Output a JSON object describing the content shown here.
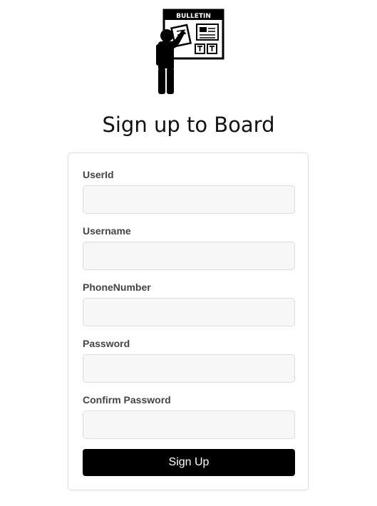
{
  "logo": {
    "icon": "bulletin-board-person-icon",
    "text": "BULLETIN"
  },
  "page": {
    "title": "Sign up to Board"
  },
  "form": {
    "fields": [
      {
        "label": "UserId",
        "value": "",
        "placeholder": ""
      },
      {
        "label": "Username",
        "value": "",
        "placeholder": ""
      },
      {
        "label": "PhoneNumber",
        "value": "",
        "placeholder": ""
      },
      {
        "label": "Password",
        "value": "",
        "placeholder": ""
      },
      {
        "label": "Confirm Password",
        "value": "",
        "placeholder": ""
      }
    ],
    "submit_label": "Sign Up"
  },
  "colors": {
    "button_background": "#000000",
    "button_text": "#ffffff",
    "input_background": "#f7f7f7",
    "card_border": "#dedede"
  }
}
